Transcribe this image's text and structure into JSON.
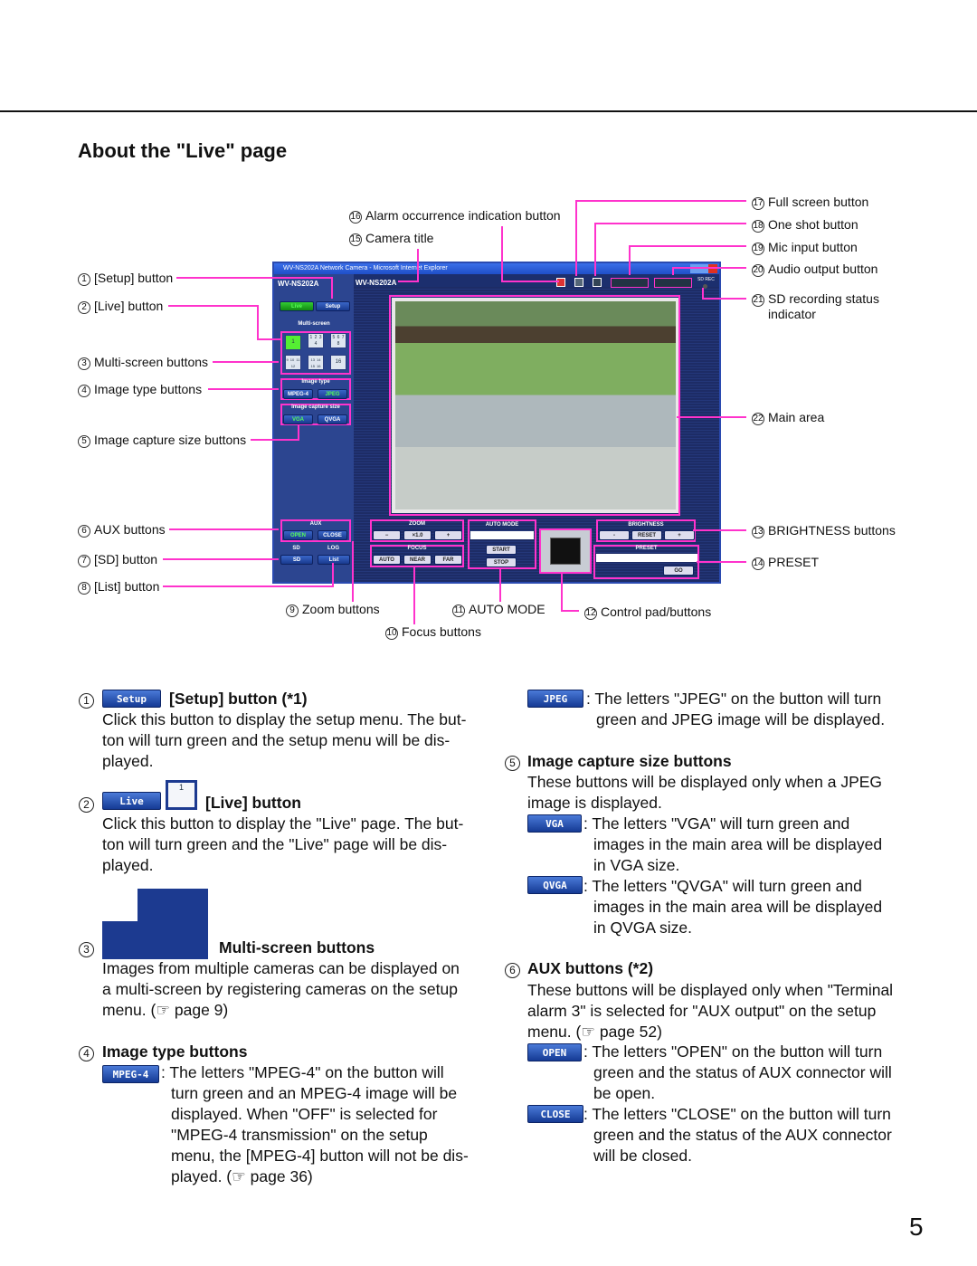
{
  "page_title": "About the \"Live\" page",
  "page_number": "5",
  "accent_color": "#ff33cc",
  "callouts": {
    "c1": {
      "n": "1",
      "t": "[Setup] button"
    },
    "c2": {
      "n": "2",
      "t": "[Live] button"
    },
    "c3": {
      "n": "3",
      "t": "Multi-screen buttons"
    },
    "c4": {
      "n": "4",
      "t": "Image type buttons"
    },
    "c5": {
      "n": "5",
      "t": "Image capture size buttons"
    },
    "c6": {
      "n": "6",
      "t": "AUX buttons"
    },
    "c7": {
      "n": "7",
      "t": "[SD] button"
    },
    "c8": {
      "n": "8",
      "t": "[List] button"
    },
    "c9": {
      "n": "9",
      "t": "Zoom buttons"
    },
    "c10": {
      "n": "10",
      "t": "Focus buttons"
    },
    "c11": {
      "n": "11",
      "t": "AUTO MODE"
    },
    "c12": {
      "n": "12",
      "t": "Control pad/buttons"
    },
    "c13": {
      "n": "13",
      "t": "BRIGHTNESS buttons"
    },
    "c14": {
      "n": "14",
      "t": "PRESET"
    },
    "c15": {
      "n": "15",
      "t": "Camera title"
    },
    "c16": {
      "n": "16",
      "t": "Alarm occurrence indication button"
    },
    "c17": {
      "n": "17",
      "t": "Full screen button"
    },
    "c18": {
      "n": "18",
      "t": "One shot button"
    },
    "c19": {
      "n": "19",
      "t": "Mic input button"
    },
    "c20": {
      "n": "20",
      "t": "Audio output button"
    },
    "c21": {
      "n": "21",
      "t": "SD recording status",
      "t2": "indicator"
    },
    "c22": {
      "n": "22",
      "t": "Main area"
    }
  },
  "camera_ui": {
    "window_title": "WV-NS202A Network Camera - Microsoft Internet Explorer",
    "model_small": "WV-NS202A",
    "camera_title": "WV-NS202A",
    "live": "Live",
    "setup": "Setup",
    "multiscreen": "Multi-screen",
    "ms_buttons": [
      "1",
      "1 2 3 4",
      "5 6 7 8",
      "9 10 11 12",
      "13 14 15 16",
      "16"
    ],
    "image_type": "Image type",
    "mpeg4": "MPEG-4",
    "jpeg": "JPEG",
    "capture_size": "Image capture size",
    "vga": "VGA",
    "qvga": "QVGA",
    "aux": "AUX",
    "open": "OPEN",
    "close": "CLOSE",
    "sd": "SD",
    "log": "LOG",
    "sd_btn": "SD",
    "list": "List",
    "zoom": "ZOOM",
    "zoom_val": "×1.0",
    "focus": "FOCUS",
    "auto": "AUTO",
    "near": "NEAR",
    "far": "FAR",
    "auto_mode": "AUTO MODE",
    "start": "START",
    "stop": "STOP",
    "brightness": "BRIGHTNESS",
    "minus": "-",
    "reset": "RESET",
    "plus": "+",
    "preset": "PRESET",
    "go": "GO",
    "sd_rec": "SD REC"
  },
  "sections": {
    "s1": {
      "n": "1",
      "btn": "Setup",
      "heading": "[Setup] button (*1)",
      "lines": [
        "Click this button to display the setup menu. The but-",
        "ton will turn green and the setup menu will be dis-",
        "played."
      ]
    },
    "s2": {
      "n": "2",
      "btn": "Live",
      "btn2": "1",
      "heading": "[Live] button",
      "lines": [
        "Click this button to display the \"Live\" page. The but-",
        "ton will turn green and the \"Live\" page will be dis-",
        "played."
      ]
    },
    "s3": {
      "n": "3",
      "heading": "Multi-screen buttons",
      "lines": [
        "Images from multiple cameras can be displayed on",
        "a multi-screen by registering cameras on the setup",
        "menu. (☞ page 9)"
      ]
    },
    "s4": {
      "n": "4",
      "heading": "Image type buttons",
      "btn": "MPEG-4",
      "lines": [
        ": The letters \"MPEG-4\" on the button will",
        "turn green and an MPEG-4 image will be",
        "displayed. When \"OFF\" is selected for",
        "\"MPEG-4 transmission\" on the setup",
        "menu, the [MPEG-4] button will not be dis-",
        "played. (☞ page 36)"
      ]
    },
    "s4b": {
      "btn": "JPEG",
      "lines": [
        ": The letters \"JPEG\" on the button will turn",
        "green and JPEG image will be displayed."
      ]
    },
    "s5": {
      "n": "5",
      "heading": "Image capture size buttons",
      "lines": [
        "These buttons will be displayed only when a JPEG",
        "image is displayed."
      ],
      "vga": {
        "btn": "VGA",
        "lines": [
          ": The letters \"VGA\" will turn green and",
          "images in the main area will be displayed",
          "in VGA size."
        ]
      },
      "qvga": {
        "btn": "QVGA",
        "lines": [
          ": The letters \"QVGA\" will turn green and",
          "images in the main area will be displayed",
          "in QVGA size."
        ]
      }
    },
    "s6": {
      "n": "6",
      "heading": "AUX buttons (*2)",
      "lines": [
        "These buttons will be displayed only when \"Terminal",
        "alarm 3\" is selected for \"AUX output\" on the setup",
        "menu.  (☞ page 52)"
      ],
      "open": {
        "btn": "OPEN",
        "lines": [
          ": The letters \"OPEN\" on the button will turn",
          "green and the status of AUX connector will",
          "be open."
        ]
      },
      "close": {
        "btn": "CLOSE",
        "lines": [
          ": The letters \"CLOSE\" on the button will turn",
          "green and the status of the AUX connector",
          "will be closed."
        ]
      }
    }
  }
}
